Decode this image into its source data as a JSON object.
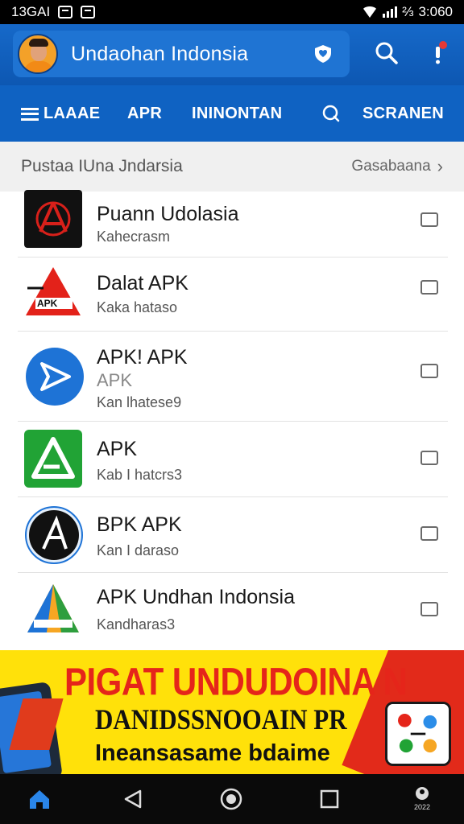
{
  "status_bar": {
    "time_left": "13GAI",
    "battery_text": "⅔",
    "time_right": "3:060"
  },
  "app_bar": {
    "title": "Undaohan Indonsia",
    "icons": [
      "avatar",
      "shield-heart-icon",
      "search-icon",
      "notification-icon"
    ]
  },
  "tabs": [
    {
      "label": "LAAAE",
      "icon": "menu-icon"
    },
    {
      "label": "APR"
    },
    {
      "label": "ININONTAN"
    },
    {
      "label": "SCRANEN",
      "icon": "search-icon"
    }
  ],
  "breadcrumb": {
    "title": "Pustaa IUna Jndarsia",
    "link": "Gasabaana"
  },
  "apps": [
    {
      "name": "Puann Udolasia",
      "subtitle": "Kahecrasm",
      "note": ""
    },
    {
      "name": "Dalat APK",
      "subtitle": "Kaka hataso",
      "note": ""
    },
    {
      "name": "APK! APK",
      "subtitle": "Kan lhatese9",
      "note": "APK"
    },
    {
      "name": "APK",
      "subtitle": "Kab I hatcrs3",
      "note": ""
    },
    {
      "name": "BPK APK",
      "subtitle": "Kan I daraso",
      "note": ""
    },
    {
      "name": "APK Undhan Indonsia",
      "subtitle": "Kandharas3",
      "note": ""
    }
  ],
  "banner": {
    "line1": "PIGAT UNDUDOINA N",
    "line2": "DANIDSSNOOAIN PR",
    "line3": "Ineansasame bdaime"
  },
  "nav_bar": {
    "items": [
      "home-icon",
      "back-icon",
      "home-circle-icon",
      "recents-icon",
      "profile-icon"
    ],
    "profile_label": "2022"
  },
  "colors": {
    "primary": "#1669c9",
    "tab_bar": "#0f62c2",
    "banner_yellow": "#ffe10a",
    "banner_red": "#e5251a"
  }
}
